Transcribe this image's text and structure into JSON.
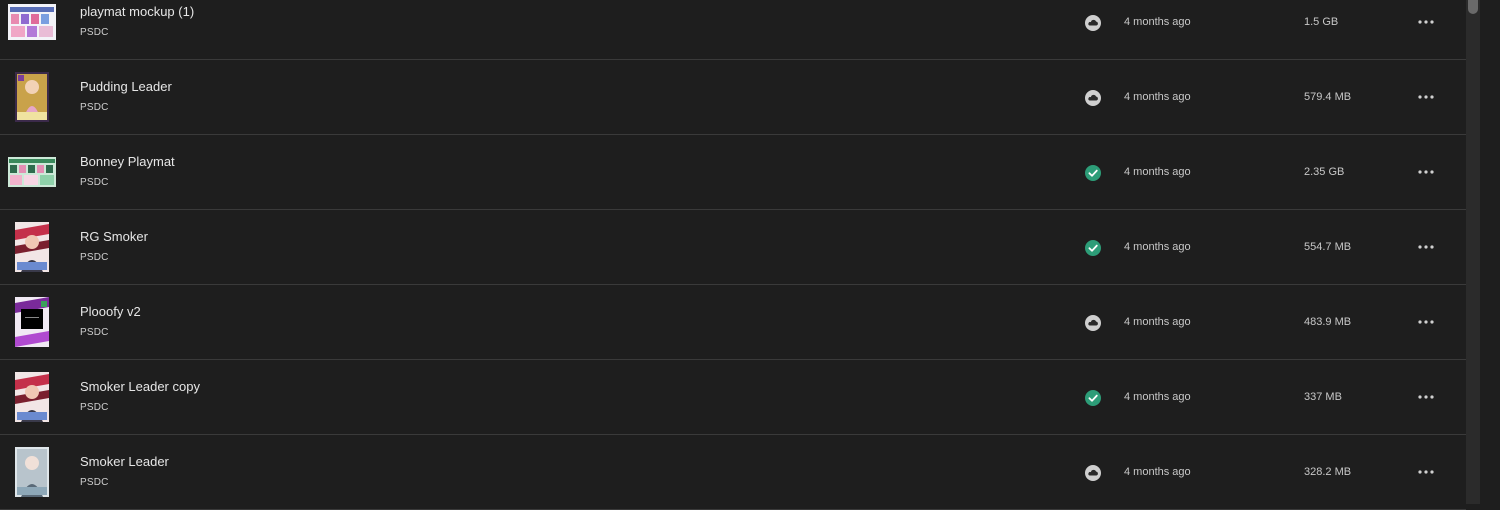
{
  "files": [
    {
      "name": "playmat mockup (1)",
      "type": "PSDC",
      "status": "cloud-icon",
      "modified": "4 months ago",
      "size": "1.5 GB",
      "thumb": "landscape-pink"
    },
    {
      "name": "Pudding Leader",
      "type": "PSDC",
      "status": "cloud-icon",
      "modified": "4 months ago",
      "size": "579.4 MB",
      "thumb": "portrait-gold"
    },
    {
      "name": "Bonney Playmat",
      "type": "PSDC",
      "status": "synced-check-icon",
      "modified": "4 months ago",
      "size": "2.35 GB",
      "thumb": "landscape-green"
    },
    {
      "name": "RG Smoker",
      "type": "PSDC",
      "status": "synced-check-icon",
      "modified": "4 months ago",
      "size": "554.7 MB",
      "thumb": "portrait-red"
    },
    {
      "name": "Plooofy v2",
      "type": "PSDC",
      "status": "cloud-icon",
      "modified": "4 months ago",
      "size": "483.9 MB",
      "thumb": "portrait-purple"
    },
    {
      "name": "Smoker Leader copy",
      "type": "PSDC",
      "status": "synced-check-icon",
      "modified": "4 months ago",
      "size": "337 MB",
      "thumb": "portrait-red"
    },
    {
      "name": "Smoker Leader",
      "type": "PSDC",
      "status": "cloud-icon",
      "modified": "4 months ago",
      "size": "328.2 MB",
      "thumb": "portrait-grey"
    }
  ],
  "colors": {
    "background": "#1e1e1e",
    "divider": "#3a3a3a",
    "synced": "#2d9d78",
    "cloud_badge": "#cfcfcf"
  }
}
